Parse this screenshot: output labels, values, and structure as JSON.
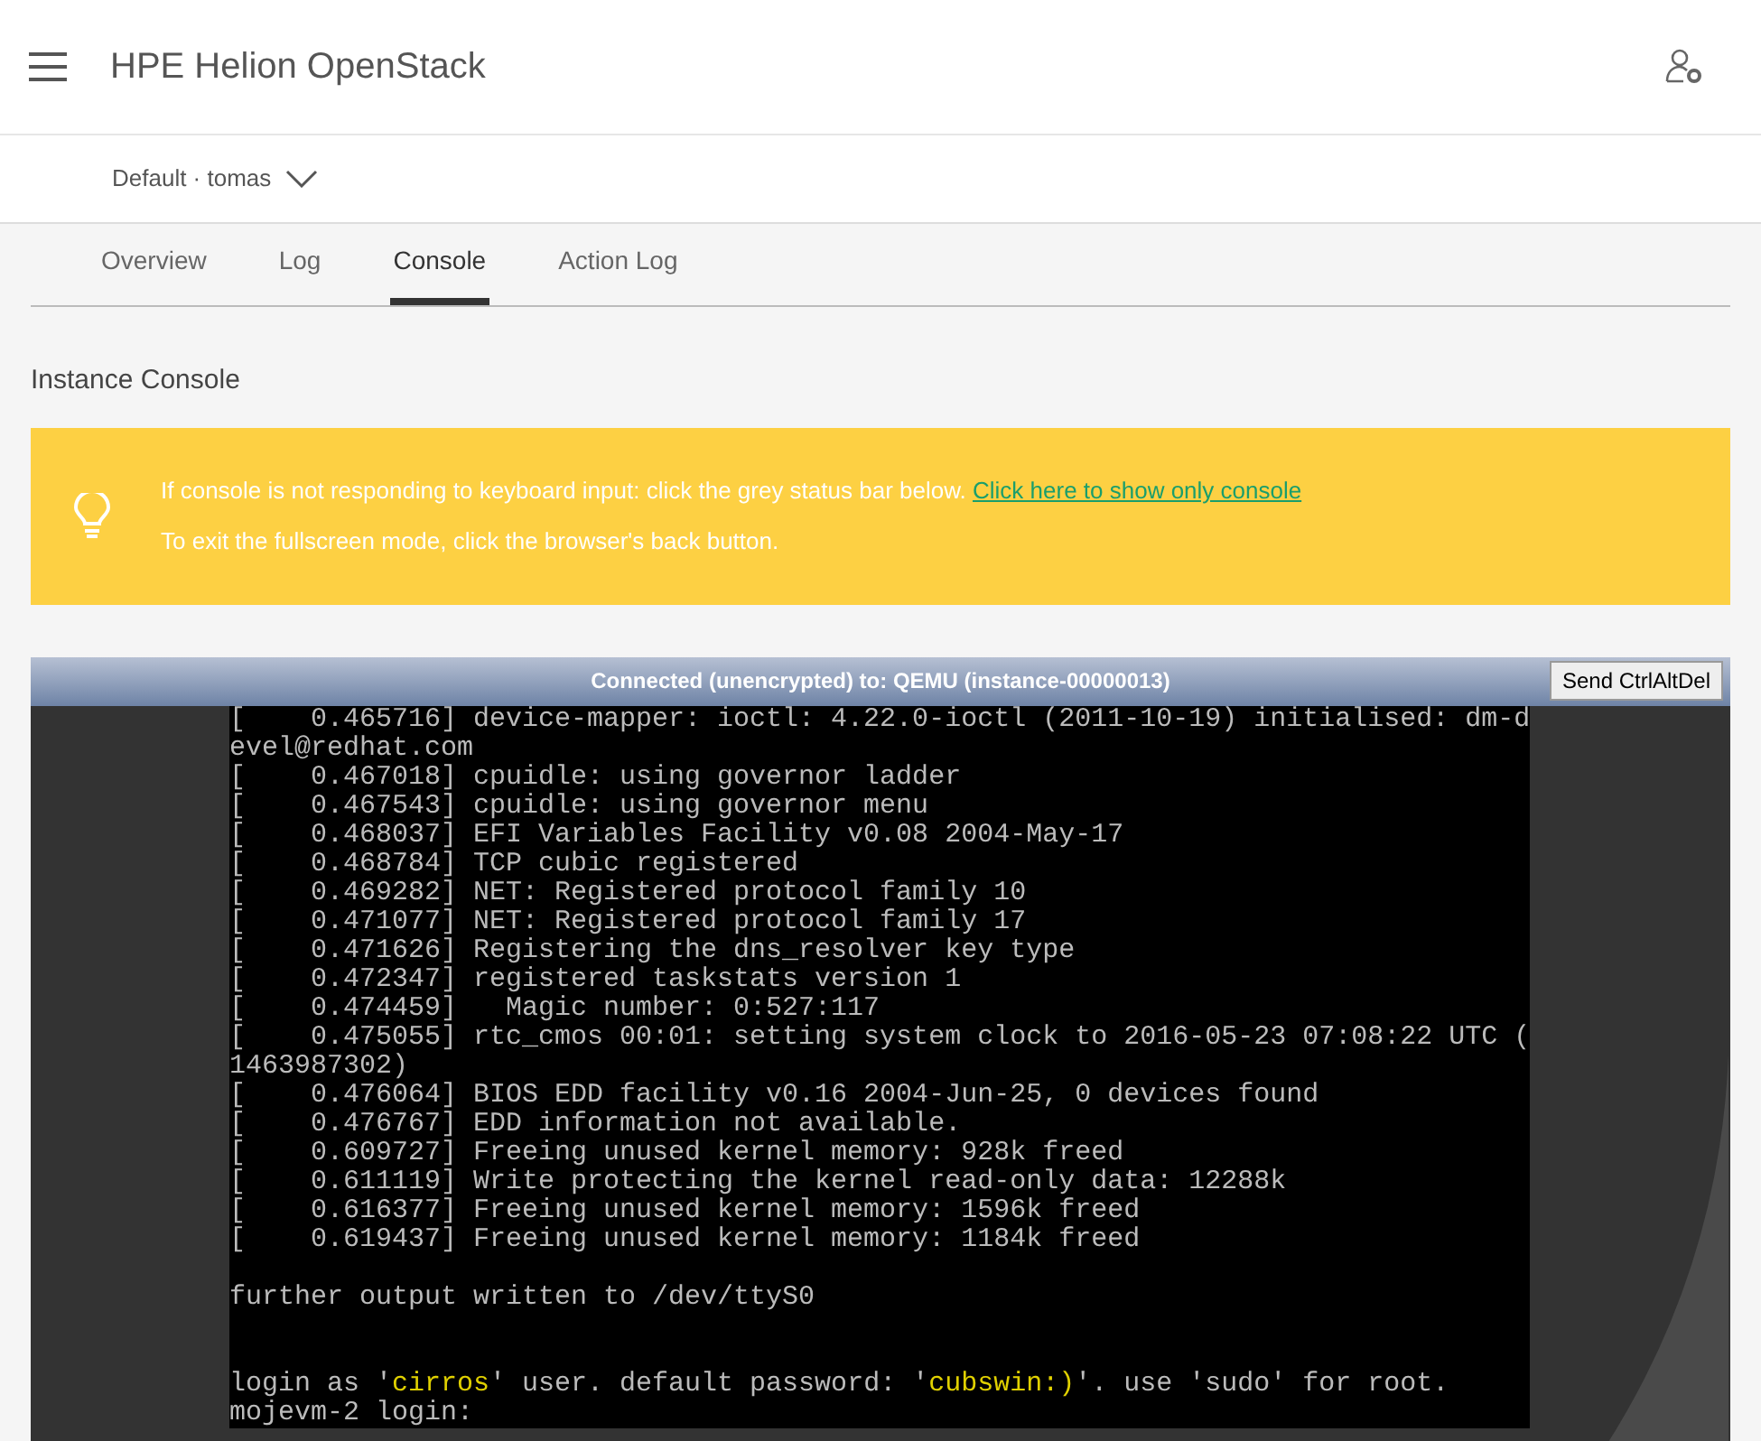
{
  "header": {
    "title": "HPE Helion OpenStack"
  },
  "project": {
    "label": "Default · tomas"
  },
  "tabs": [
    {
      "label": "Overview",
      "selected": false
    },
    {
      "label": "Log",
      "selected": false
    },
    {
      "label": "Console",
      "selected": true
    },
    {
      "label": "Action Log",
      "selected": false
    }
  ],
  "section_title": "Instance Console",
  "alert": {
    "message": "If console is not responding to keyboard input: click the grey status bar below.",
    "link": "Click here to show only console",
    "note": "To exit the fullscreen mode, click the browser's back button."
  },
  "console": {
    "status": "Connected (unencrypted) to: QEMU (instance-00000013)",
    "button": "Send CtrlAltDel",
    "lines": [
      {
        "kind": "text",
        "text": "[    0.465716] device-mapper: ioctl: 4.22.0-ioctl (2011-10-19) initialised: dm-d"
      },
      {
        "kind": "text",
        "text": "evel@redhat.com"
      },
      {
        "kind": "text",
        "text": "[    0.467018] cpuidle: using governor ladder"
      },
      {
        "kind": "text",
        "text": "[    0.467543] cpuidle: using governor menu"
      },
      {
        "kind": "text",
        "text": "[    0.468037] EFI Variables Facility v0.08 2004-May-17"
      },
      {
        "kind": "text",
        "text": "[    0.468784] TCP cubic registered"
      },
      {
        "kind": "text",
        "text": "[    0.469282] NET: Registered protocol family 10"
      },
      {
        "kind": "text",
        "text": "[    0.471077] NET: Registered protocol family 17"
      },
      {
        "kind": "text",
        "text": "[    0.471626] Registering the dns_resolver key type"
      },
      {
        "kind": "text",
        "text": "[    0.472347] registered taskstats version 1"
      },
      {
        "kind": "text",
        "text": "[    0.474459]   Magic number: 0:527:117"
      },
      {
        "kind": "text",
        "text": "[    0.475055] rtc_cmos 00:01: setting system clock to 2016-05-23 07:08:22 UTC ("
      },
      {
        "kind": "text",
        "text": "1463987302)"
      },
      {
        "kind": "text",
        "text": "[    0.476064] BIOS EDD facility v0.16 2004-Jun-25, 0 devices found"
      },
      {
        "kind": "text",
        "text": "[    0.476767] EDD information not available."
      },
      {
        "kind": "text",
        "text": "[    0.609727] Freeing unused kernel memory: 928k freed"
      },
      {
        "kind": "text",
        "text": "[    0.611119] Write protecting the kernel read-only data: 12288k"
      },
      {
        "kind": "text",
        "text": "[    0.616377] Freeing unused kernel memory: 1596k freed"
      },
      {
        "kind": "text",
        "text": "[    0.619437] Freeing unused kernel memory: 1184k freed"
      },
      {
        "kind": "blank"
      },
      {
        "kind": "text",
        "text": "further output written to /dev/ttyS0"
      },
      {
        "kind": "blank"
      },
      {
        "kind": "blank"
      },
      {
        "kind": "parts",
        "parts": [
          {
            "text": "login as '",
            "highlight": false
          },
          {
            "text": "cirros",
            "highlight": true
          },
          {
            "text": "' user. default password: '",
            "highlight": false
          },
          {
            "text": "cubswin:)",
            "highlight": true
          },
          {
            "text": "'. use 'sudo' for root.",
            "highlight": false
          }
        ]
      },
      {
        "kind": "text",
        "text": "mojevm-2 login:"
      }
    ]
  }
}
